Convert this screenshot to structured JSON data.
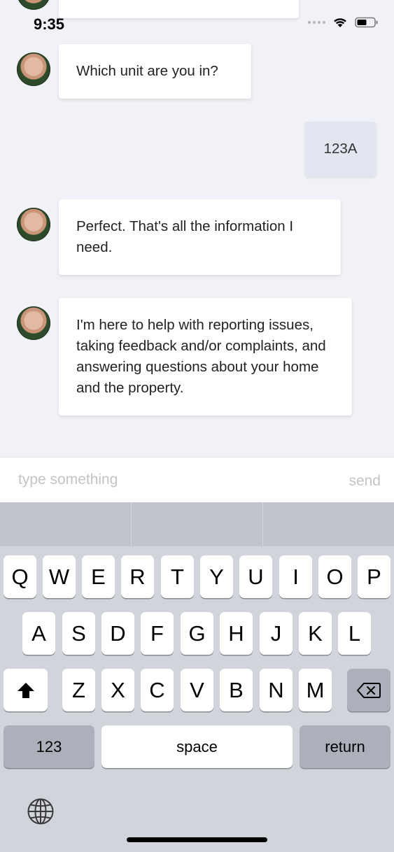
{
  "status_bar": {
    "time": "9:35"
  },
  "messages": [
    {
      "sender": "bot",
      "text": "Which unit are you in?"
    },
    {
      "sender": "user",
      "text": "123A"
    },
    {
      "sender": "bot",
      "text": "Perfect.  That's all the information I need."
    },
    {
      "sender": "bot",
      "text": "I'm here to help with reporting issues, taking feedback and/or complaints, and answering questions about your home and the property."
    }
  ],
  "composer": {
    "placeholder": "type something",
    "send_label": "send"
  },
  "keyboard": {
    "row1": [
      "Q",
      "W",
      "E",
      "R",
      "T",
      "Y",
      "U",
      "I",
      "O",
      "P"
    ],
    "row2": [
      "A",
      "S",
      "D",
      "F",
      "G",
      "H",
      "J",
      "K",
      "L"
    ],
    "row3": [
      "Z",
      "X",
      "C",
      "V",
      "B",
      "N",
      "M"
    ],
    "numbers_label": "123",
    "space_label": "space",
    "return_label": "return"
  },
  "icons": [
    "wifi-icon",
    "battery-icon",
    "shift-icon",
    "delete-icon",
    "globe-icon"
  ]
}
